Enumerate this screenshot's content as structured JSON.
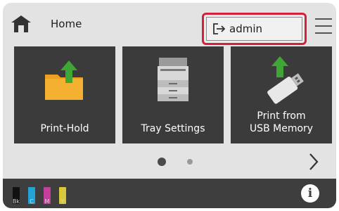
{
  "header": {
    "home_label": "Home",
    "login_label": "admin"
  },
  "tiles": [
    {
      "label": "Print-Hold",
      "icon": "folder-upload-icon"
    },
    {
      "label": "Tray Settings",
      "icon": "printer-icon"
    },
    {
      "label_line1": "Print from",
      "label_line2": "USB Memory",
      "icon": "usb-memory-icon"
    }
  ],
  "pager": {
    "current_page": 1,
    "total_pages": 2
  },
  "toner": [
    {
      "label": "Bk",
      "color": "#111111"
    },
    {
      "label": "C",
      "color": "#22a3d6"
    },
    {
      "label": "M",
      "color": "#c0409a"
    },
    {
      "label": "Y",
      "color": "#d8c83a"
    }
  ],
  "info_label": "i",
  "colors": {
    "highlight_border": "#d3213d",
    "tile_background": "#3b3b3b",
    "arrow_green": "#3fa535",
    "folder_orange": "#f0a020"
  }
}
